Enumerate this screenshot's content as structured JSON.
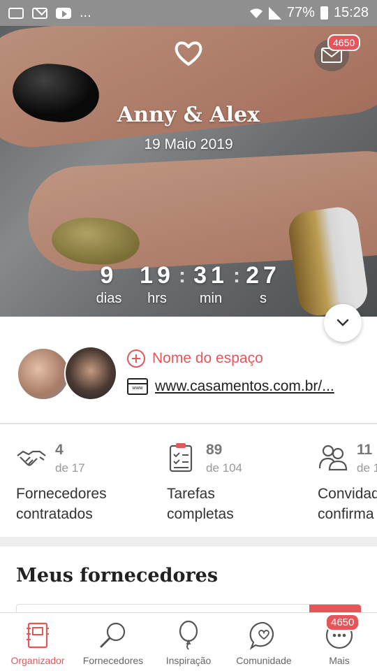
{
  "status_bar": {
    "battery": "77%",
    "time": "15:28",
    "more": "..."
  },
  "hero": {
    "couple_names": "Anny & Alex",
    "date": "19 Maio 2019",
    "message_badge": "4650",
    "countdown": [
      {
        "value": "9",
        "unit": "dias"
      },
      {
        "value": "19",
        "unit": "hrs"
      },
      {
        "value": "31",
        "unit": "min"
      },
      {
        "value": "27",
        "unit": "s"
      }
    ],
    "colon": ":"
  },
  "venue": {
    "add_label": "Nome do espaço",
    "website": "www.casamentos.com.br/..."
  },
  "stats": [
    {
      "count": "4",
      "of": "de 17",
      "label_1": "Fornecedores",
      "label_2": "contratados"
    },
    {
      "count": "89",
      "of": "de 104",
      "label_1": "Tarefas",
      "label_2": "completas"
    },
    {
      "count": "11",
      "of": "de 1",
      "label_1": "Convidad",
      "label_2": "confirma"
    }
  ],
  "section": {
    "title": "Meus fornecedores"
  },
  "bottom_nav": {
    "items": [
      {
        "label": "Organizador",
        "icon": "planner-icon"
      },
      {
        "label": "Fornecedores",
        "icon": "search-icon"
      },
      {
        "label": "Inspiração",
        "icon": "balloon-icon"
      },
      {
        "label": "Comunidade",
        "icon": "chat-heart-icon"
      },
      {
        "label": "Mais",
        "icon": "more-icon"
      }
    ],
    "more_badge": "4650"
  },
  "colors": {
    "accent": "#e5565b",
    "status_bar": "#8f8f8f"
  }
}
